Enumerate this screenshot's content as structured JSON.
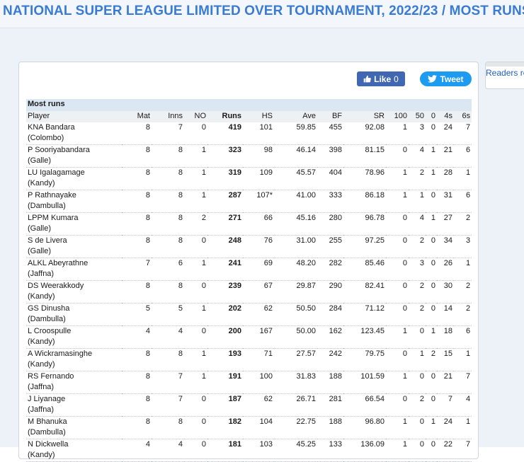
{
  "page": {
    "title": "NATIONAL SUPER LEAGUE LIMITED OVER TOURNAMENT, 2022/23 / MOST RUNS"
  },
  "social": {
    "like_label": "Like",
    "like_count": "0",
    "tweet_label": "Tweet"
  },
  "sidebar": {
    "readers_text": "Readers re"
  },
  "table": {
    "caption": "Most runs",
    "headers": {
      "player": "Player",
      "mat": "Mat",
      "inns": "Inns",
      "no": "NO",
      "runs": "Runs",
      "hs": "HS",
      "ave": "Ave",
      "bf": "BF",
      "sr": "SR",
      "hundreds": "100",
      "fifties": "50",
      "ducks": "0",
      "fours": "4s",
      "sixes": "6s"
    },
    "rows": [
      {
        "name": "KNA Bandara",
        "team": "(Colombo)",
        "mat": "8",
        "inns": "7",
        "no": "0",
        "runs": "419",
        "hs": "101",
        "ave": "59.85",
        "bf": "455",
        "sr": "92.08",
        "hundreds": "1",
        "fifties": "3",
        "ducks": "0",
        "fours": "24",
        "sixes": "7"
      },
      {
        "name": "P Sooriyabandara",
        "team": "(Galle)",
        "mat": "8",
        "inns": "8",
        "no": "1",
        "runs": "323",
        "hs": "98",
        "ave": "46.14",
        "bf": "398",
        "sr": "81.15",
        "hundreds": "0",
        "fifties": "4",
        "ducks": "1",
        "fours": "21",
        "sixes": "6"
      },
      {
        "name": "LU Igalagamage",
        "team": "(Kandy)",
        "mat": "8",
        "inns": "8",
        "no": "1",
        "runs": "319",
        "hs": "109",
        "ave": "45.57",
        "bf": "404",
        "sr": "78.96",
        "hundreds": "1",
        "fifties": "2",
        "ducks": "1",
        "fours": "28",
        "sixes": "1"
      },
      {
        "name": "P Rathnayake",
        "team": "(Dambulla)",
        "mat": "8",
        "inns": "8",
        "no": "1",
        "runs": "287",
        "hs": "107*",
        "ave": "41.00",
        "bf": "333",
        "sr": "86.18",
        "hundreds": "1",
        "fifties": "1",
        "ducks": "0",
        "fours": "31",
        "sixes": "6"
      },
      {
        "name": "LPPM Kumara",
        "team": "(Galle)",
        "mat": "8",
        "inns": "8",
        "no": "2",
        "runs": "271",
        "hs": "66",
        "ave": "45.16",
        "bf": "280",
        "sr": "96.78",
        "hundreds": "0",
        "fifties": "4",
        "ducks": "1",
        "fours": "27",
        "sixes": "2"
      },
      {
        "name": "S de Livera",
        "team": "(Galle)",
        "mat": "8",
        "inns": "8",
        "no": "0",
        "runs": "248",
        "hs": "76",
        "ave": "31.00",
        "bf": "255",
        "sr": "97.25",
        "hundreds": "0",
        "fifties": "2",
        "ducks": "0",
        "fours": "34",
        "sixes": "3"
      },
      {
        "name": "ALKL Abeyrathne",
        "team": "(Jaffna)",
        "mat": "7",
        "inns": "6",
        "no": "1",
        "runs": "241",
        "hs": "69",
        "ave": "48.20",
        "bf": "282",
        "sr": "85.46",
        "hundreds": "0",
        "fifties": "3",
        "ducks": "0",
        "fours": "26",
        "sixes": "1"
      },
      {
        "name": "DS Weerakkody",
        "team": "(Kandy)",
        "mat": "8",
        "inns": "8",
        "no": "0",
        "runs": "239",
        "hs": "67",
        "ave": "29.87",
        "bf": "290",
        "sr": "82.41",
        "hundreds": "0",
        "fifties": "2",
        "ducks": "0",
        "fours": "30",
        "sixes": "2"
      },
      {
        "name": "GS Dinusha",
        "team": "(Dambulla)",
        "mat": "5",
        "inns": "5",
        "no": "1",
        "runs": "202",
        "hs": "62",
        "ave": "50.50",
        "bf": "284",
        "sr": "71.12",
        "hundreds": "0",
        "fifties": "2",
        "ducks": "0",
        "fours": "14",
        "sixes": "2"
      },
      {
        "name": "L Croospulle",
        "team": "(Kandy)",
        "mat": "4",
        "inns": "4",
        "no": "0",
        "runs": "200",
        "hs": "167",
        "ave": "50.00",
        "bf": "162",
        "sr": "123.45",
        "hundreds": "1",
        "fifties": "0",
        "ducks": "1",
        "fours": "18",
        "sixes": "6"
      },
      {
        "name": "A Wickramasinghe",
        "team": "(Kandy)",
        "mat": "8",
        "inns": "8",
        "no": "1",
        "runs": "193",
        "hs": "71",
        "ave": "27.57",
        "bf": "242",
        "sr": "79.75",
        "hundreds": "0",
        "fifties": "1",
        "ducks": "2",
        "fours": "15",
        "sixes": "1"
      },
      {
        "name": "RS Fernando",
        "team": "(Jaffna)",
        "mat": "8",
        "inns": "7",
        "no": "1",
        "runs": "191",
        "hs": "100",
        "ave": "31.83",
        "bf": "188",
        "sr": "101.59",
        "hundreds": "1",
        "fifties": "0",
        "ducks": "0",
        "fours": "21",
        "sixes": "7"
      },
      {
        "name": "J Liyanage",
        "team": "(Jaffna)",
        "mat": "8",
        "inns": "7",
        "no": "0",
        "runs": "187",
        "hs": "62",
        "ave": "26.71",
        "bf": "281",
        "sr": "66.54",
        "hundreds": "0",
        "fifties": "2",
        "ducks": "0",
        "fours": "7",
        "sixes": "4"
      },
      {
        "name": "M Bhanuka",
        "team": "(Dambulla)",
        "mat": "8",
        "inns": "8",
        "no": "0",
        "runs": "182",
        "hs": "104",
        "ave": "22.75",
        "bf": "188",
        "sr": "96.80",
        "hundreds": "1",
        "fifties": "0",
        "ducks": "1",
        "fours": "24",
        "sixes": "1"
      },
      {
        "name": "N Dickwella",
        "team": "(Kandy)",
        "mat": "4",
        "inns": "4",
        "no": "0",
        "runs": "181",
        "hs": "103",
        "ave": "45.25",
        "bf": "133",
        "sr": "136.09",
        "hundreds": "1",
        "fifties": "0",
        "ducks": "0",
        "fours": "22",
        "sixes": "7"
      }
    ]
  }
}
